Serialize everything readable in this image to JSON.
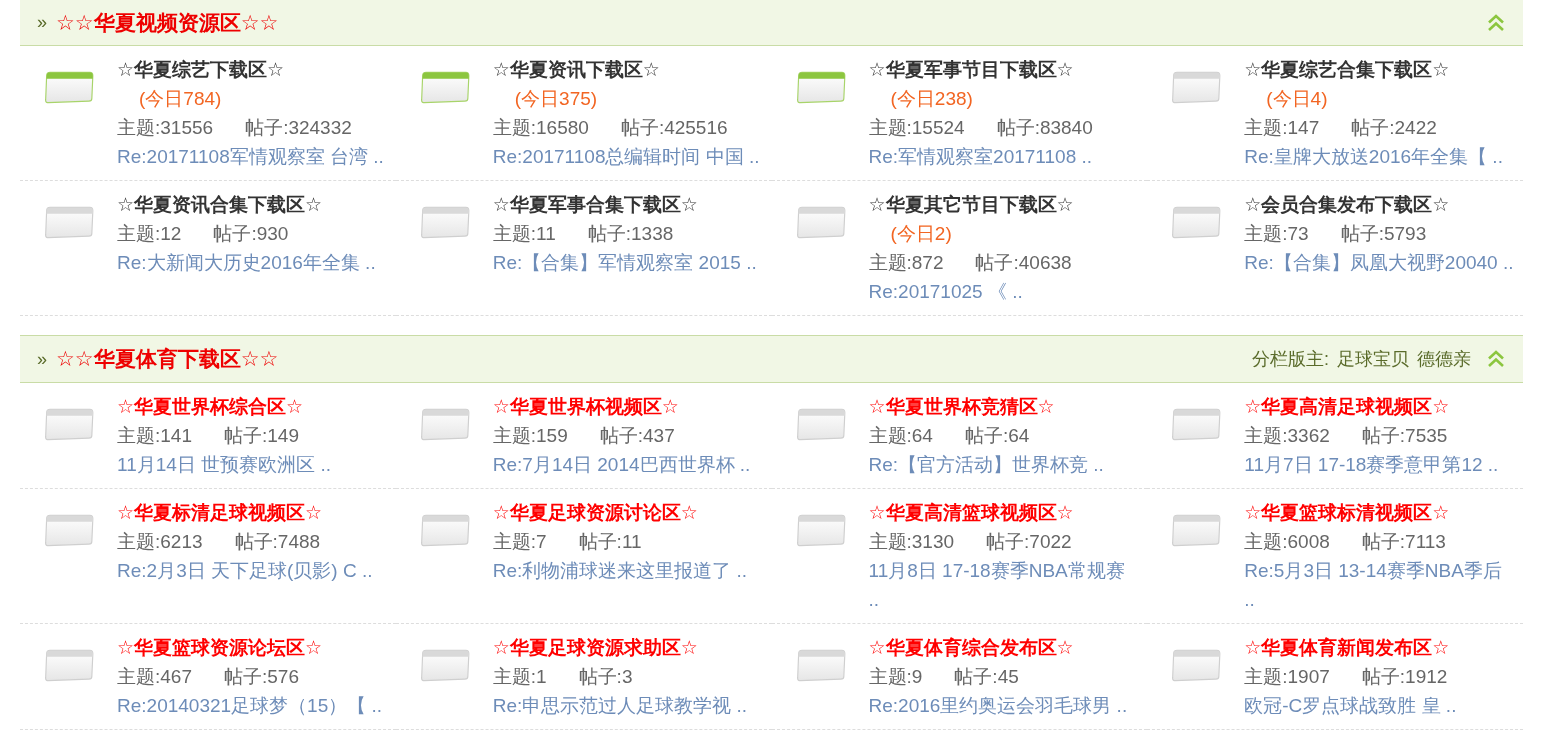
{
  "sections": [
    {
      "marker": "»",
      "title": "☆☆华夏视频资源区☆☆",
      "forums": [
        {
          "name": "☆华夏综艺下载区☆",
          "color": "#333333",
          "new": true,
          "today": "(今日784)",
          "topics": "主题:31556",
          "posts": "帖子:324332",
          "last_post": "Re:20171108军情观察室 台湾 .."
        },
        {
          "name": "☆华夏资讯下载区☆",
          "color": "#333333",
          "new": true,
          "today": "(今日375)",
          "topics": "主题:16580",
          "posts": "帖子:425516",
          "last_post": "Re:20171108总编辑时间 中国 .."
        },
        {
          "name": "☆华夏军事节目下载区☆",
          "color": "#333333",
          "new": true,
          "today": "(今日238)",
          "topics": "主题:15524",
          "posts": "帖子:83840",
          "last_post": "Re:军情观察室20171108 .."
        },
        {
          "name": "☆华夏综艺合集下载区☆",
          "color": "#333333",
          "new": false,
          "today": "(今日4)",
          "topics": "主题:147",
          "posts": "帖子:2422",
          "last_post": "Re:皇牌大放送2016年全集【 .."
        },
        {
          "name": "☆华夏资讯合集下载区☆",
          "color": "#333333",
          "new": false,
          "topics": "主题:12",
          "posts": "帖子:930",
          "last_post": "Re:大新闻大历史2016年全集 .."
        },
        {
          "name": "☆华夏军事合集下载区☆",
          "color": "#333333",
          "new": false,
          "topics": "主题:11",
          "posts": "帖子:1338",
          "last_post": "Re:【合集】军情观察室 2015 .."
        },
        {
          "name": "☆华夏其它节目下载区☆",
          "color": "#333333",
          "new": false,
          "today": "(今日2)",
          "topics": "主题:872",
          "posts": "帖子:40638",
          "last_post": "Re:20171025 《 .."
        },
        {
          "name": "☆会员合集发布下载区☆",
          "color": "#333333",
          "new": false,
          "topics": "主题:73",
          "posts": "帖子:5793",
          "last_post": "Re:【合集】凤凰大视野20040 .."
        }
      ]
    },
    {
      "marker": "»",
      "title": "☆☆华夏体育下载区☆☆",
      "moderators": {
        "label": "分栏版主:",
        "names": [
          "足球宝贝",
          "德德亲"
        ]
      },
      "forums": [
        {
          "name": "☆华夏世界杯综合区☆",
          "color": "#ff0000",
          "new": false,
          "topics": "主题:141",
          "posts": "帖子:149",
          "last_post": "11月14日 世预赛欧洲区 .."
        },
        {
          "name": "☆华夏世界杯视频区☆",
          "color": "#ff0000",
          "new": false,
          "topics": "主题:159",
          "posts": "帖子:437",
          "last_post": "Re:7月14日 2014巴西世界杯 .."
        },
        {
          "name": "☆华夏世界杯竞猜区☆",
          "color": "#ff0000",
          "new": false,
          "topics": "主题:64",
          "posts": "帖子:64",
          "last_post": "Re:【官方活动】世界杯竞 .."
        },
        {
          "name": "☆华夏高清足球视频区☆",
          "color": "#ff0000",
          "new": false,
          "topics": "主题:3362",
          "posts": "帖子:7535",
          "last_post": "11月7日 17-18赛季意甲第12 .."
        },
        {
          "name": "☆华夏标清足球视频区☆",
          "color": "#ff0000",
          "new": false,
          "topics": "主题:6213",
          "posts": "帖子:7488",
          "last_post": "Re:2月3日 天下足球(贝影) C .."
        },
        {
          "name": "☆华夏足球资源讨论区☆",
          "color": "#ff0000",
          "new": false,
          "topics": "主题:7",
          "posts": "帖子:11",
          "last_post": "Re:利物浦球迷来这里报道了 .."
        },
        {
          "name": "☆华夏高清篮球视频区☆",
          "color": "#ff0000",
          "new": false,
          "topics": "主题:3130",
          "posts": "帖子:7022",
          "last_post": "11月8日 17-18赛季NBA常规赛 .."
        },
        {
          "name": "☆华夏篮球标清视频区☆",
          "color": "#ff0000",
          "new": false,
          "topics": "主题:6008",
          "posts": "帖子:7113",
          "last_post": "Re:5月3日 13-14赛季NBA季后 .."
        },
        {
          "name": "☆华夏篮球资源论坛区☆",
          "color": "#ff0000",
          "new": false,
          "topics": "主题:467",
          "posts": "帖子:576",
          "last_post": "Re:20140321足球梦（15）【 .."
        },
        {
          "name": "☆华夏足球资源求助区☆",
          "color": "#ff0000",
          "new": false,
          "topics": "主题:1",
          "posts": "帖子:3",
          "last_post": "Re:申思示范过人足球教学视 .."
        },
        {
          "name": "☆华夏体育综合发布区☆",
          "color": "#ff0000",
          "new": false,
          "topics": "主题:9",
          "posts": "帖子:45",
          "last_post": "Re:2016里约奥运会羽毛球男 .."
        },
        {
          "name": "☆华夏体育新闻发布区☆",
          "color": "#ff0000",
          "new": false,
          "topics": "主题:1907",
          "posts": "帖子:1912",
          "last_post": "欧冠-C罗点球战致胜 皇 .."
        }
      ]
    }
  ]
}
